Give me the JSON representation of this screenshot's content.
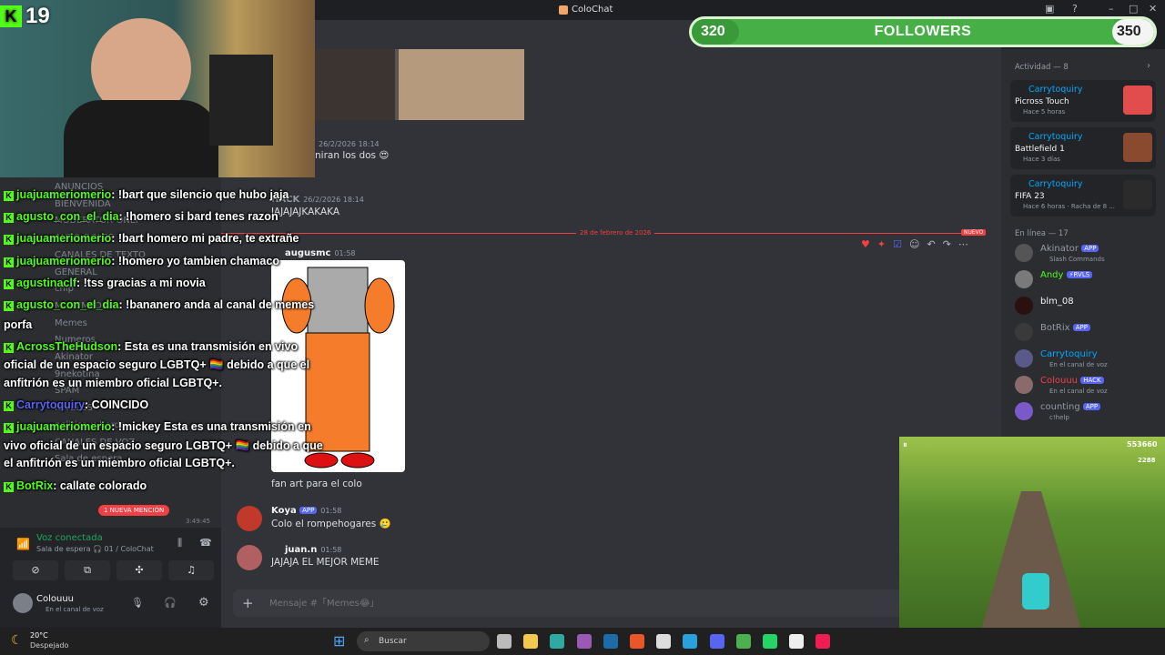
{
  "app": {
    "title": "ColoChat"
  },
  "stream_overlay": {
    "viewer_count": "19",
    "followers": {
      "current": "320",
      "label": "FOLLOWERS",
      "goal": "350",
      "progress": 0.914
    },
    "chat": [
      {
        "user": "juajuameriomerio",
        "text": ": !bart que silencio que hubo jaja"
      },
      {
        "user": "agusto_con_el_dia",
        "text": ": !homero si bard tenes razon"
      },
      {
        "user": "juajuameriomerio",
        "text": ": !bart homero mi padre, te extrañe"
      },
      {
        "user": "juajuameriomerio",
        "text": ": !homero yo tambien chamaco"
      },
      {
        "user": "agustinaclf",
        "text": ": !tss gracias a mi novia"
      },
      {
        "user": "agusto_con_el_dia",
        "text": ": !bananero anda al canal de memes"
      },
      {
        "user": "",
        "text": "porfa"
      },
      {
        "user": "AcrossTheHudson",
        "text": ": Esta es una transmisión en vivo"
      },
      {
        "user": "",
        "text": "oficial de un espacio seguro LGBTQ+ 🏳️‍🌈 debido a que el"
      },
      {
        "user": "",
        "text": "anfitrión es un miembro oficial LGBTQ+."
      },
      {
        "user": "Carrytoquiry",
        "text": ": COINCIDO"
      },
      {
        "user": "juajuameriomerio",
        "text": ": !mickey Esta es una transmisión en"
      },
      {
        "user": "",
        "text": "vivo oficial de un espacio seguro LGBTQ+ 🏳️‍🌈 debido a que"
      },
      {
        "user": "",
        "text": "el anfitrión es un miembro oficial LGBTQ+."
      },
      {
        "user": "BotRix",
        "text": ": callate colorado"
      }
    ],
    "game": {
      "score": "553660",
      "coins": "2288"
    }
  },
  "sidebar": {
    "channels": [
      "ANUNCIOS",
      "BIENVENIDA",
      "MODERATOR-ONLY",
      "AUTO-ROLES",
      "CANALES DE TEXTO",
      "GENERAL",
      "chip",
      "MULTIMEDIA",
      "Memes",
      "Numeros",
      "Akinator",
      "9nekotina",
      "SPAM",
      "NIVELES",
      "politica-y-bardo",
      "CANALES DE VOZ",
      "Sala de espera"
    ],
    "new_mention": "1 NUEVA MENCIÓN",
    "voice_time": "3:49:45"
  },
  "voice": {
    "status": "Voz conectada",
    "channel": "Sala de espera 🎧 01 / ColoChat"
  },
  "user_panel": {
    "name": "Colouuu",
    "status": "En el canal de voz"
  },
  "chat": {
    "date_divider": "28 de febrero de 2026",
    "new_label": "NUEVO",
    "messages": [
      {
        "author": "",
        "time": "26/2/2026 18:14",
        "text": "niran los dos 😍"
      },
      {
        "author": "HACK",
        "time": "26/2/2026 18:14",
        "text": "JAJAJAJKAKAKA"
      },
      {
        "author": "augusmc",
        "time": "01:58",
        "text": "fan art para el colo"
      },
      {
        "author": "Koya",
        "tag": "APP",
        "time": "01:58",
        "text": "Colo el rompehogares 🥲"
      },
      {
        "author": "juan.n",
        "time": "01:58",
        "text": "JAJAJA EL MEJOR MEME"
      }
    ],
    "composer_placeholder": "Mensaje #「Memes😂」"
  },
  "members": {
    "activity_header": "Actividad — 8",
    "activities": [
      {
        "name": "Carrytoquiry",
        "game": "Picross Touch",
        "time": "Hace 5 horas"
      },
      {
        "name": "Carrytoquiry",
        "game": "Battlefield 1",
        "time": "Hace 3 días"
      },
      {
        "name": "Carrytoquiry",
        "game": "FIFA 23",
        "time": "Hace 6 horas · Racha de 8 ..."
      }
    ],
    "online_header": "En línea — 17",
    "online": [
      {
        "name": "Akinator",
        "tag": "APP",
        "status": "Slash Commands",
        "color": "#949ba4"
      },
      {
        "name": "Andy",
        "tag": "⚡RVLS",
        "status": "",
        "color": "#53fc18"
      },
      {
        "name": "blm_08",
        "tag": "",
        "status": "",
        "color": "#f2f3f5"
      },
      {
        "name": "BotRix",
        "tag": "APP",
        "status": "",
        "color": "#949ba4"
      },
      {
        "name": "Carrytoquiry",
        "tag": "",
        "status": "En el canal de voz",
        "color": "#00a8fc"
      },
      {
        "name": "Colouuu",
        "tag": "HACK",
        "status": "En el canal de voz",
        "color": "#f23f43"
      },
      {
        "name": "counting",
        "tag": "APP",
        "status": "c!help",
        "color": "#949ba4"
      }
    ]
  },
  "taskbar": {
    "weather_temp": "20°C",
    "weather_desc": "Despejado",
    "search": "Buscar"
  },
  "colors": {
    "accent": "#5865f2",
    "kick_green": "#53fc18",
    "bg": "#313338"
  }
}
